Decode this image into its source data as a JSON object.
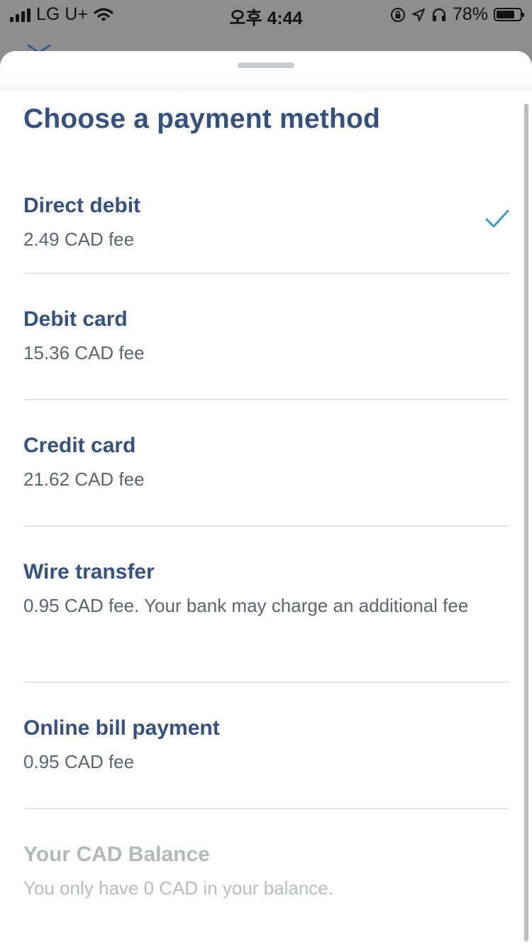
{
  "status_bar": {
    "carrier": "LG U+",
    "time": "오후 4:44",
    "battery": "78%",
    "battery_level": 0.78
  },
  "sheet": {
    "title": "Choose a payment method",
    "options": [
      {
        "name": "Direct debit",
        "fee": "2.49 CAD fee",
        "selected": true,
        "enabled": true
      },
      {
        "name": "Debit card",
        "fee": "15.36 CAD fee",
        "selected": false,
        "enabled": true
      },
      {
        "name": "Credit card",
        "fee": "21.62 CAD fee",
        "selected": false,
        "enabled": true
      },
      {
        "name": "Wire transfer",
        "fee": "0.95 CAD fee. Your bank may charge an additional fee",
        "selected": false,
        "enabled": true
      },
      {
        "name": "Online bill payment",
        "fee": "0.95 CAD fee",
        "selected": false,
        "enabled": true
      },
      {
        "name": "Your CAD Balance",
        "fee": "You only have 0 CAD in your balance.",
        "selected": false,
        "enabled": false
      }
    ]
  },
  "colors": {
    "title": "#37517e",
    "check": "#3b9bc4",
    "divider": "#e4e5e8",
    "disabled_text": "#b5b7bb"
  },
  "icons": {
    "signal": "signal-icon",
    "wifi": "wifi-icon",
    "rotation_lock": "rotation-lock-icon",
    "location": "location-arrow-icon",
    "headphones": "headphones-icon",
    "battery": "battery-icon",
    "check": "checkmark-icon"
  }
}
